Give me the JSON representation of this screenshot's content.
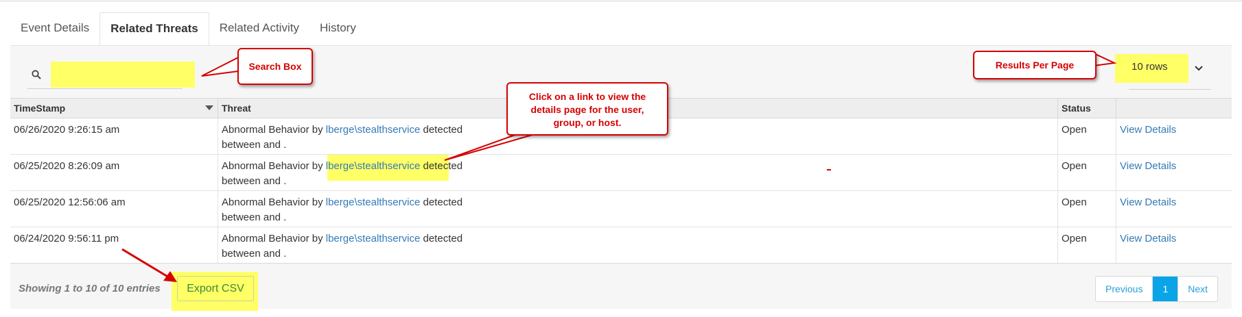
{
  "tabs": [
    {
      "label": "Event Details"
    },
    {
      "label": "Related Threats"
    },
    {
      "label": "Related Activity"
    },
    {
      "label": "History"
    }
  ],
  "search": {
    "placeholder": "",
    "value": ""
  },
  "rows_per_page": {
    "value": "10 rows"
  },
  "table": {
    "headers": [
      "TimeStamp",
      "Threat",
      "Status",
      ""
    ],
    "rows": [
      {
        "timestamp": "06/26/2020 9:26:15 am",
        "threat_prefix": "Abnormal Behavior by ",
        "threat_link": "lberge\\stealthservice",
        "threat_suffix": " detected",
        "threat_line2": "between and .",
        "status": "Open",
        "action": "View Details"
      },
      {
        "timestamp": "06/25/2020 8:26:09 am",
        "threat_prefix": "Abnormal Behavior by ",
        "threat_link": "lberge\\stealthservice",
        "threat_suffix": " detected",
        "threat_line2": "between and .",
        "status": "Open",
        "action": "View Details"
      },
      {
        "timestamp": "06/25/2020 12:56:06 am",
        "threat_prefix": "Abnormal Behavior by ",
        "threat_link": "lberge\\stealthservice",
        "threat_suffix": " detected",
        "threat_line2": "between and .",
        "status": "Open",
        "action": "View Details"
      },
      {
        "timestamp": "06/24/2020 9:56:11 pm",
        "threat_prefix": "Abnormal Behavior by ",
        "threat_link": "lberge\\stealthservice",
        "threat_suffix": " detected",
        "threat_line2": "between and .",
        "status": "Open",
        "action": "View Details"
      }
    ]
  },
  "footer": {
    "info": "Showing 1 to 10 of 10 entries",
    "export_label": "Export CSV",
    "pagination": {
      "previous": "Previous",
      "current": "1",
      "next": "Next"
    }
  },
  "annotations": {
    "search_box": "Search Box",
    "results_per_page": "Results Per Page",
    "link_help_line1": "Click on a link to view the",
    "link_help_line2": "details page for the user,",
    "link_help_line3": "group, or host."
  },
  "colors": {
    "annotation_red": "#d50000",
    "highlight_yellow": "#ffff66",
    "link_blue": "#337ab7",
    "tab_active_underline": "#e24a6e",
    "page_active": "#0aa5e8"
  },
  "icons": {
    "search": "search-icon",
    "dropdown": "chevron-down-icon",
    "sort": "sort-desc-icon"
  }
}
